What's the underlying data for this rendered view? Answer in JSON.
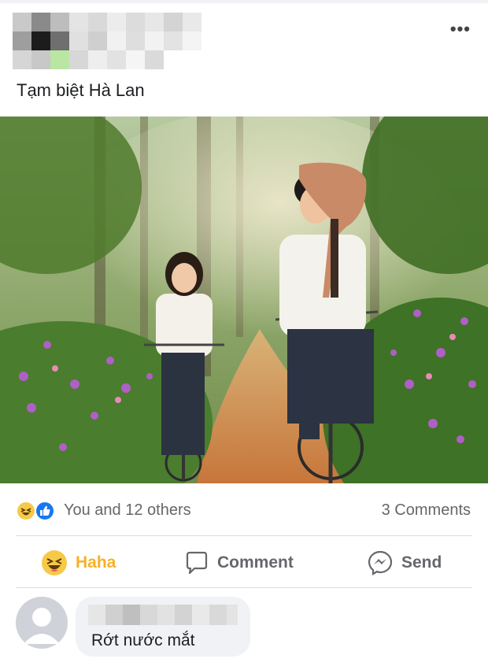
{
  "post": {
    "text": "Tạm biệt Hà Lan",
    "more_icon": "•••"
  },
  "photo": {
    "icon": "movie-still-image"
  },
  "reactions": {
    "summary": "You and 12 others",
    "comments": "3 Comments",
    "icons": [
      "haha-icon",
      "like-icon"
    ]
  },
  "actions": {
    "haha": "Haha",
    "comment": "Comment",
    "send": "Send"
  },
  "comment": {
    "text": "Rớt nước mắt"
  },
  "colors": {
    "haha_accent": "#f7b125",
    "like_blue": "#1877f2",
    "muted": "#65676b"
  }
}
